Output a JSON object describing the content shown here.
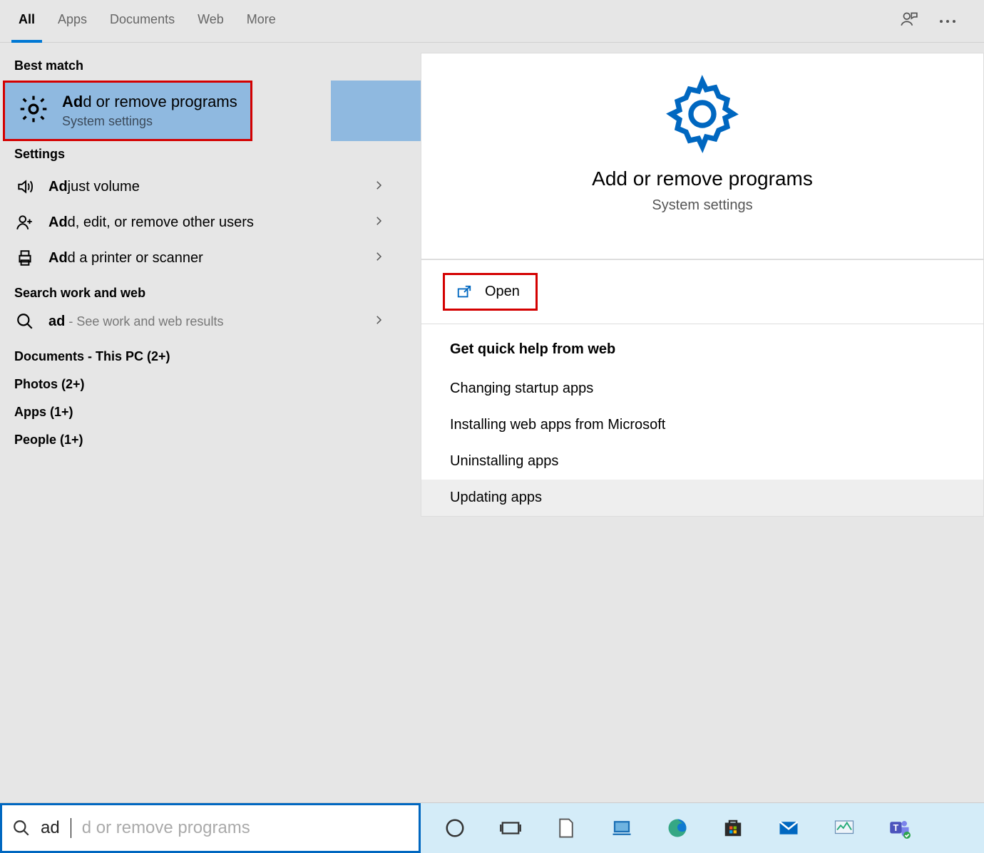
{
  "tabs": {
    "items": [
      "All",
      "Apps",
      "Documents",
      "Web",
      "More"
    ],
    "active_index": 0
  },
  "sections": {
    "best_match": "Best match",
    "settings": "Settings",
    "search_web": "Search work and web",
    "documents": "Documents - This PC (2+)",
    "photos": "Photos (2+)",
    "apps": "Apps (1+)",
    "people": "People (1+)"
  },
  "best_match": {
    "bold": "Ad",
    "rest": "d or remove programs",
    "subtitle": "System settings"
  },
  "settings_rows": [
    {
      "bold": "Ad",
      "rest": "just volume",
      "icon": "volume"
    },
    {
      "bold": "Ad",
      "rest": "d, edit, or remove other users",
      "icon": "user-plus"
    },
    {
      "bold": "Ad",
      "rest": "d a printer or scanner",
      "icon": "printer"
    }
  ],
  "web_row": {
    "bold": "ad",
    "hint": " - See work and web results",
    "icon": "search"
  },
  "preview": {
    "title": "Add or remove programs",
    "subtitle": "System settings",
    "open_label": "Open"
  },
  "help": {
    "title": "Get quick help from web",
    "items": [
      "Changing startup apps",
      "Installing web apps from Microsoft",
      "Uninstalling apps",
      "Updating apps"
    ],
    "hover_index": 3
  },
  "search_input": {
    "typed": "ad",
    "ghost": "d or remove programs"
  }
}
